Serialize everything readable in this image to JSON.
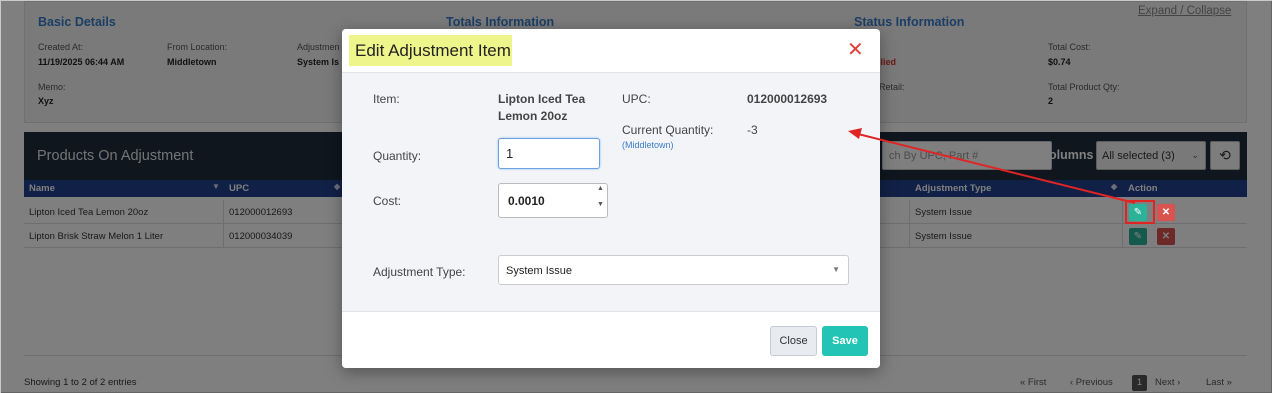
{
  "basic_details": {
    "title": "Basic Details",
    "created_at_label": "Created At:",
    "created_at_value": "11/19/2025 06:44 AM",
    "from_location_label": "From Location:",
    "from_location_value": "Middletown",
    "adjustment_label": "Adjustmen",
    "adjustment_value": "System Is",
    "memo_label": "Memo:",
    "memo_value": "Xyz"
  },
  "totals": {
    "title": "Totals Information"
  },
  "status": {
    "title": "Status Information",
    "status_value_partial": "plied",
    "retail_label_partial": "Retail:",
    "total_cost_label": "Total Cost:",
    "total_cost_value": "$0.74",
    "total_qty_label": "Total Product Qty:",
    "total_qty_value": "2"
  },
  "expand_collapse": "Expand / Collapse",
  "products": {
    "title": "Products On Adjustment",
    "search_placeholder": "ch By UPC, Part #",
    "columns_label": "Columns",
    "columns_value": "All selected (3)",
    "headers": {
      "name": "Name",
      "upc": "UPC",
      "adjustment_type": "Adjustment Type",
      "action": "Action"
    },
    "rows": [
      {
        "name": "Lipton Iced Tea Lemon 20oz",
        "upc": "012000012693",
        "adjustment_type": "System Issue"
      },
      {
        "name": "Lipton Brisk Straw Melon 1 Liter",
        "upc": "012000034039",
        "adjustment_type": "System Issue"
      }
    ],
    "showing": "Showing 1 to 2 of 2 entries",
    "pager": {
      "first": "« First",
      "previous": "‹ Previous",
      "current": "1",
      "next": "Next ›",
      "last": "Last »"
    }
  },
  "modal": {
    "title": "Edit Adjustment Item",
    "item_label": "Item:",
    "item_value_line1": "Lipton Iced Tea",
    "item_value_line2": "Lemon 20oz",
    "upc_label": "UPC:",
    "upc_value": "012000012693",
    "current_qty_label": "Current Quantity:",
    "current_qty_value": "-3",
    "current_qty_location": "(Middletown)",
    "quantity_label": "Quantity:",
    "quantity_value": "1",
    "cost_label": "Cost:",
    "cost_value": "0.0010",
    "adjustment_type_label": "Adjustment Type:",
    "adjustment_type_value": "System Issue",
    "close_button": "Close",
    "save_button": "Save"
  },
  "colors": {
    "accent_blue": "#3a7dc9",
    "header_navy": "#1e2d3d",
    "table_head_blue": "#23408e",
    "save_teal": "#22c5b5",
    "delete_red": "#d9534f",
    "edit_green": "#2bb39a",
    "annotation_red": "#e02424",
    "title_highlight": "#eef58a"
  }
}
